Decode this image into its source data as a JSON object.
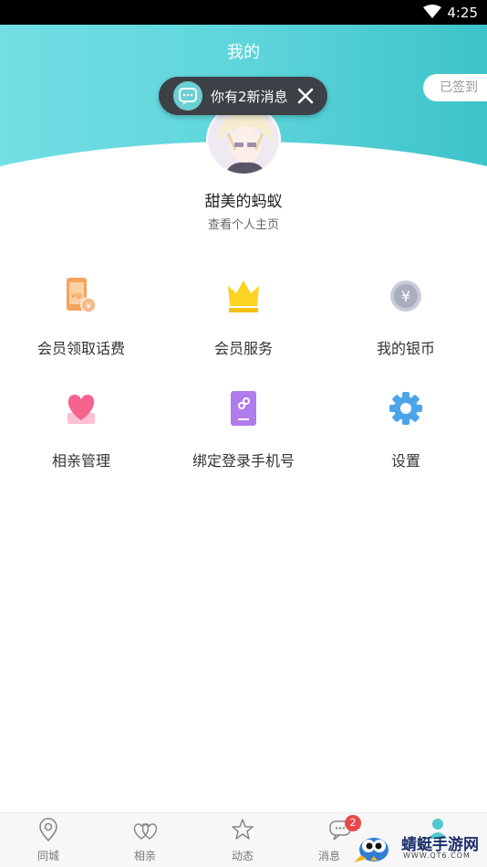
{
  "status_bar": {
    "time": "4:25",
    "wifi_icon": "wifi-icon"
  },
  "header": {
    "title": "我的",
    "signin_label": "已签到",
    "gradient_start": "#72dfe4",
    "gradient_end": "#3cc3c9"
  },
  "toast": {
    "text": "你有2新消息",
    "icon": "chat-bubble-icon",
    "close_icon": "close-icon"
  },
  "profile": {
    "username": "甜美的蚂蚁",
    "profile_link": "查看个人主页"
  },
  "menu": [
    {
      "label": "会员领取话费",
      "icon": "vip-phone-icon"
    },
    {
      "label": "会员服务",
      "icon": "crown-icon"
    },
    {
      "label": "我的银币",
      "icon": "silver-coin-icon"
    },
    {
      "label": "相亲管理",
      "icon": "heart-icon"
    },
    {
      "label": "绑定登录手机号",
      "icon": "phone-link-icon"
    },
    {
      "label": "设置",
      "icon": "gear-icon"
    }
  ],
  "bottom_nav": [
    {
      "label": "同城",
      "icon": "location-pin-icon"
    },
    {
      "label": "相亲",
      "icon": "hearts-icon"
    },
    {
      "label": "动态",
      "icon": "star-icon"
    },
    {
      "label": "消息",
      "icon": "message-icon",
      "badge": "2"
    },
    {
      "label": "",
      "icon": "person-icon",
      "active": true
    }
  ],
  "accent_color": "#5ed5db",
  "badge_color": "#e9484a",
  "watermark": {
    "text": "蜻蜓手游网",
    "url": "WWW.QT6.COM"
  }
}
